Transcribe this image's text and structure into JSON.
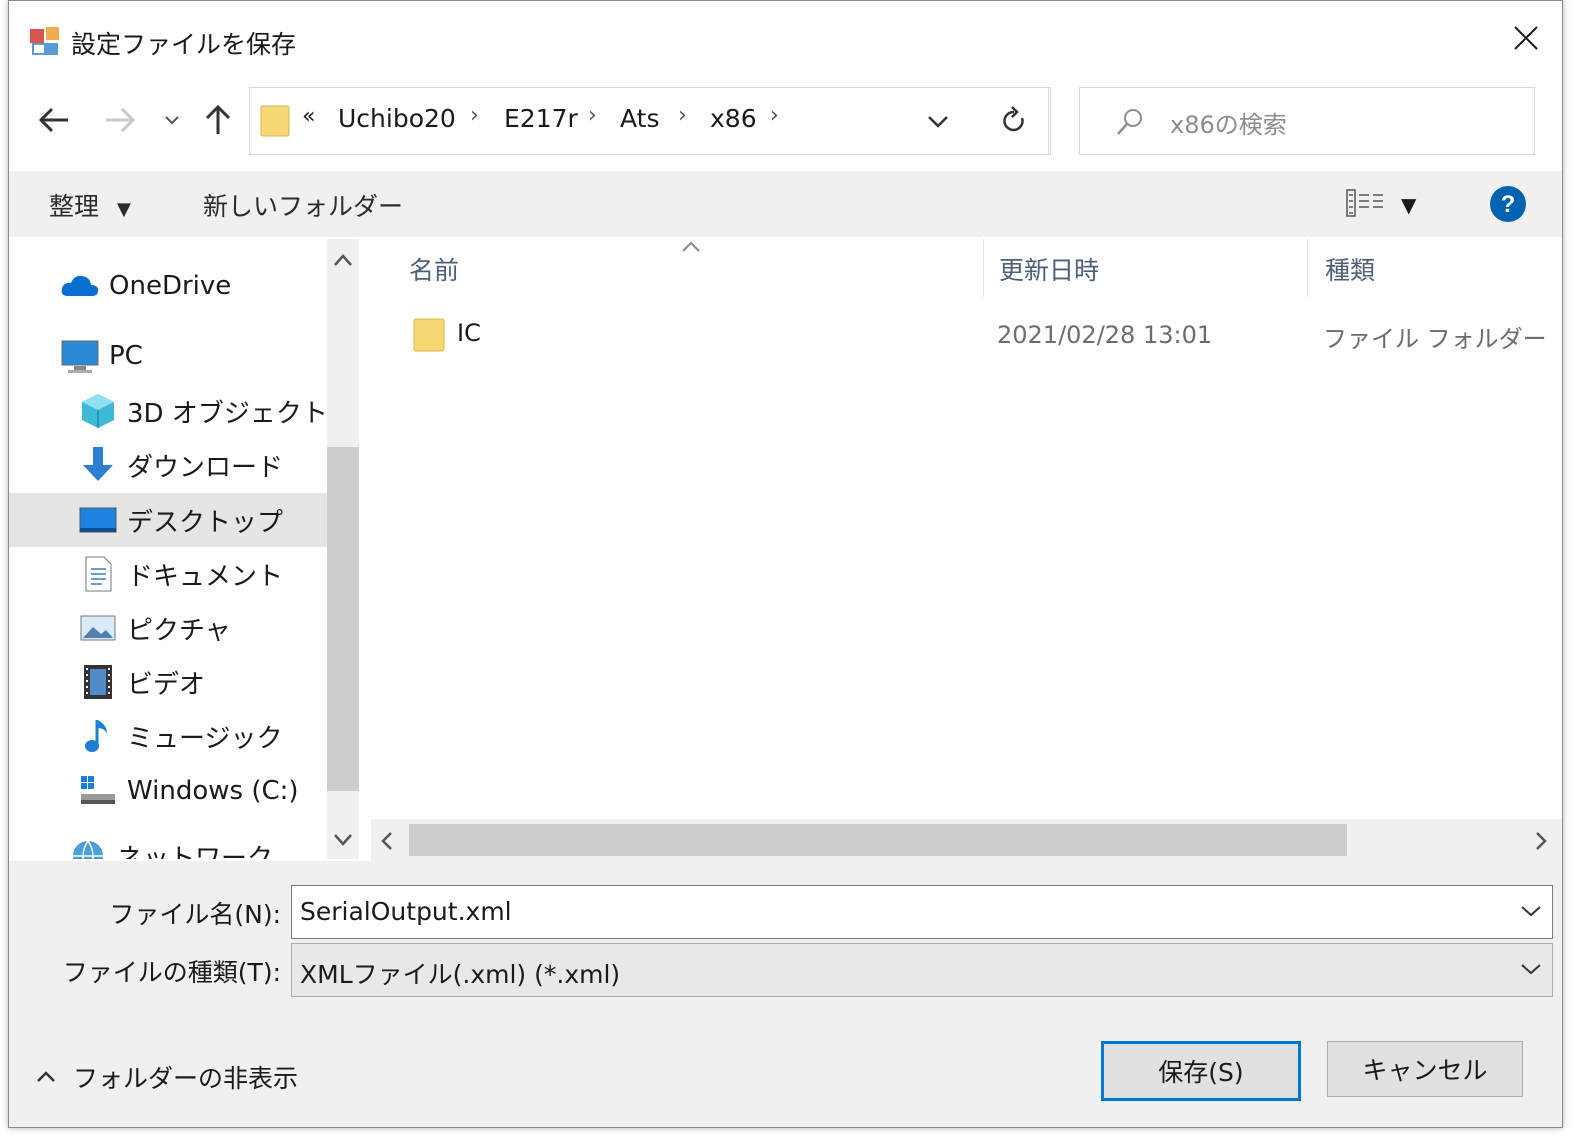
{
  "window": {
    "title": "設定ファイルを保存",
    "close_icon": "close-icon"
  },
  "nav": {
    "back_icon": "arrow-left-icon",
    "forward_icon": "arrow-right-icon",
    "recent_icon": "chevron-down-icon",
    "up_icon": "arrow-up-icon",
    "overflow": "«",
    "breadcrumb": [
      "Uchibo20",
      "E217r",
      "Ats",
      "x86"
    ],
    "refresh_icon": "refresh-icon",
    "search_placeholder": "x86の検索"
  },
  "toolbar": {
    "organize_label": "整理",
    "new_folder_label": "新しいフォルダー",
    "view_icon": "view-options-icon",
    "help_icon": "help-icon"
  },
  "navpane": {
    "items": [
      {
        "label": "OneDrive",
        "icon": "onedrive-cloud-icon"
      },
      {
        "label": "PC",
        "icon": "pc-monitor-icon"
      },
      {
        "label": "3D オブジェクト",
        "icon": "3d-objects-icon"
      },
      {
        "label": "ダウンロード",
        "icon": "download-arrow-icon"
      },
      {
        "label": "デスクトップ",
        "icon": "desktop-icon"
      },
      {
        "label": "ドキュメント",
        "icon": "document-icon"
      },
      {
        "label": "ピクチャ",
        "icon": "picture-icon"
      },
      {
        "label": "ビデオ",
        "icon": "video-icon"
      },
      {
        "label": "ミュージック",
        "icon": "music-note-icon"
      },
      {
        "label": "Windows (C:)",
        "icon": "drive-icon"
      },
      {
        "label": "ネットワーク",
        "icon": "network-icon"
      }
    ],
    "selected": "デスクトップ"
  },
  "filelist": {
    "columns": [
      "名前",
      "更新日時",
      "種類"
    ],
    "rows": [
      {
        "name": "IC",
        "modified": "2021/02/28 13:01",
        "type": "ファイル フォルダー"
      }
    ]
  },
  "form": {
    "filename_label": "ファイル名(N):",
    "filename_value": "SerialOutput.xml",
    "filetype_label": "ファイルの種類(T):",
    "filetype_value": "XMLファイル(.xml) (*.xml)",
    "hide_folders_label": "フォルダーの非表示",
    "save_label": "保存(S)",
    "cancel_label": "キャンセル"
  },
  "colors": {
    "accent": "#0078d7",
    "selected_bg": "#e5e5e5",
    "panel_bg": "#f0f0f0",
    "header_text": "#4c607a",
    "folder_yellow": "#f8d775"
  }
}
